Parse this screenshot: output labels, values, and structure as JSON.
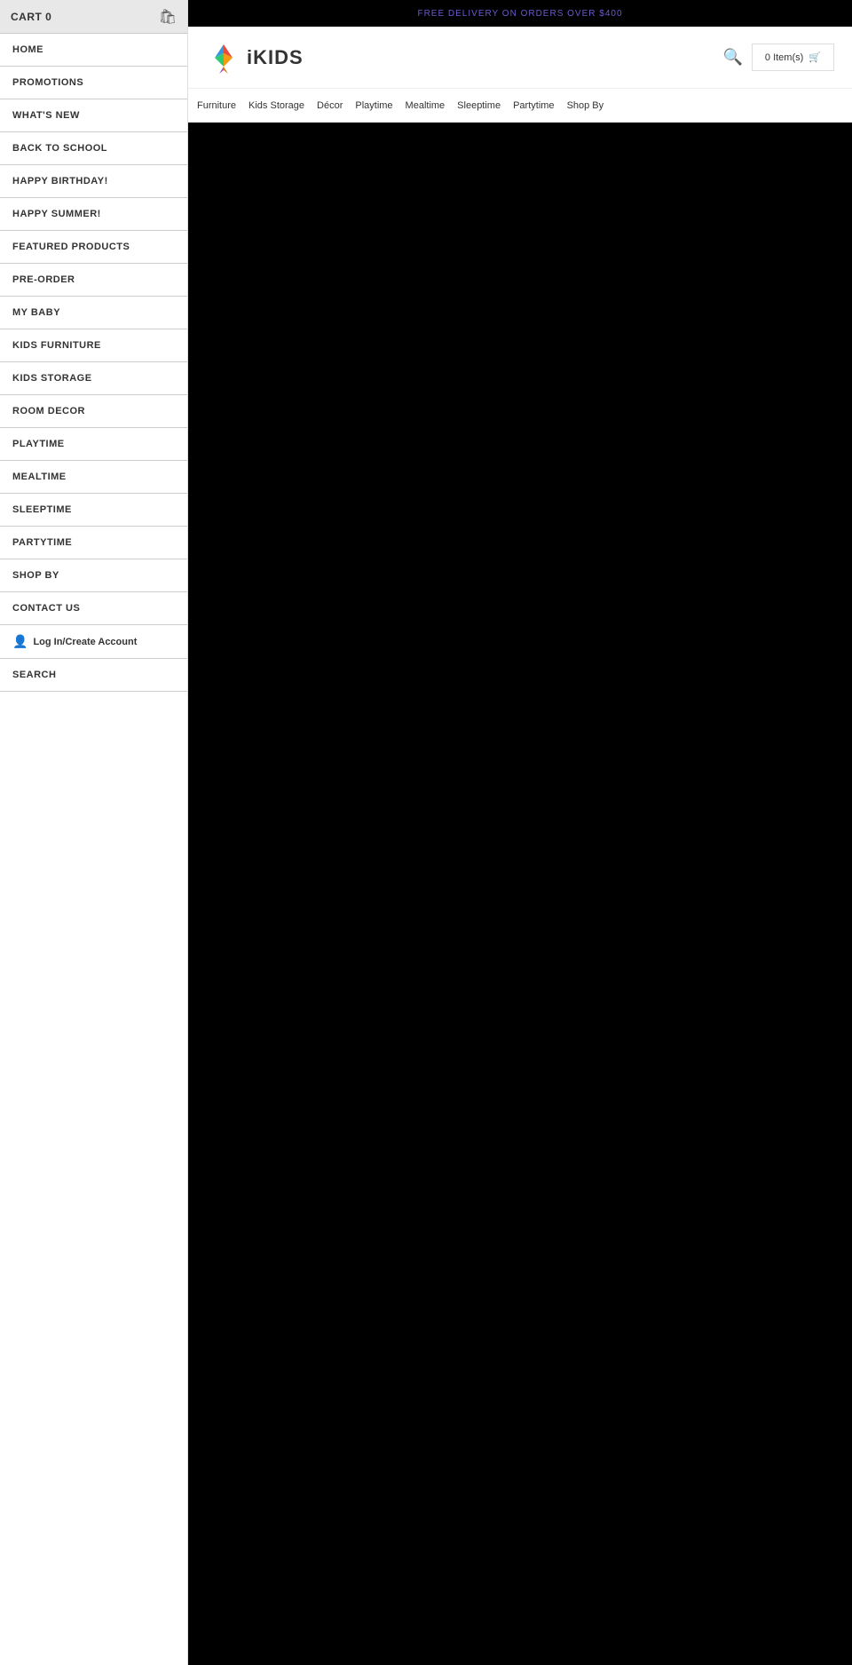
{
  "sidebar": {
    "cart": {
      "label": "CART 0",
      "icon": "🛍"
    },
    "nav_items": [
      {
        "id": "home",
        "label": "HOME"
      },
      {
        "id": "promotions",
        "label": "PROMOTIONS"
      },
      {
        "id": "whats-new",
        "label": "WHAT'S NEW"
      },
      {
        "id": "back-to-school",
        "label": "BACK TO SCHOOL"
      },
      {
        "id": "happy-birthday",
        "label": "HAPPY BIRTHDAY!"
      },
      {
        "id": "happy-summer",
        "label": "HAPPY SUMMER!"
      },
      {
        "id": "featured-products",
        "label": "FEATURED PRODUCTS"
      },
      {
        "id": "pre-order",
        "label": "PRE-ORDER"
      },
      {
        "id": "my-baby",
        "label": "MY BABY"
      },
      {
        "id": "kids-furniture",
        "label": "KIDS FURNITURE"
      },
      {
        "id": "kids-storage",
        "label": "KIDS STORAGE"
      },
      {
        "id": "room-decor",
        "label": "ROOM DECOR"
      },
      {
        "id": "playtime",
        "label": "PLAYTIME"
      },
      {
        "id": "mealtime",
        "label": "MEALTIME"
      },
      {
        "id": "sleeptime",
        "label": "SLEEPTIME"
      },
      {
        "id": "partytime",
        "label": "PARTYTIME"
      },
      {
        "id": "shop-by",
        "label": "SHOP BY"
      },
      {
        "id": "contact-us",
        "label": "CONTACT US"
      }
    ],
    "account": {
      "label": "Log In/Create Account"
    },
    "search": {
      "label": "SEARCH"
    }
  },
  "header": {
    "banner_text": "FREE DELIVERY ON ORDERS OVER $400",
    "banner_url": "#",
    "logo_text": "iKIDS",
    "search_icon": "🔍",
    "cart_label": "0 Item(s)",
    "cart_icon": "🛒"
  },
  "top_nav": {
    "items": [
      {
        "id": "furniture",
        "label": "Furniture"
      },
      {
        "id": "kids-storage",
        "label": "Kids Storage"
      },
      {
        "id": "decor",
        "label": "Décor"
      },
      {
        "id": "playtime",
        "label": "Playtime"
      },
      {
        "id": "mealtime",
        "label": "Mealtime"
      },
      {
        "id": "sleeptime",
        "label": "Sleeptime"
      },
      {
        "id": "partytime",
        "label": "Partytime"
      },
      {
        "id": "shop-by",
        "label": "Shop By"
      }
    ]
  }
}
